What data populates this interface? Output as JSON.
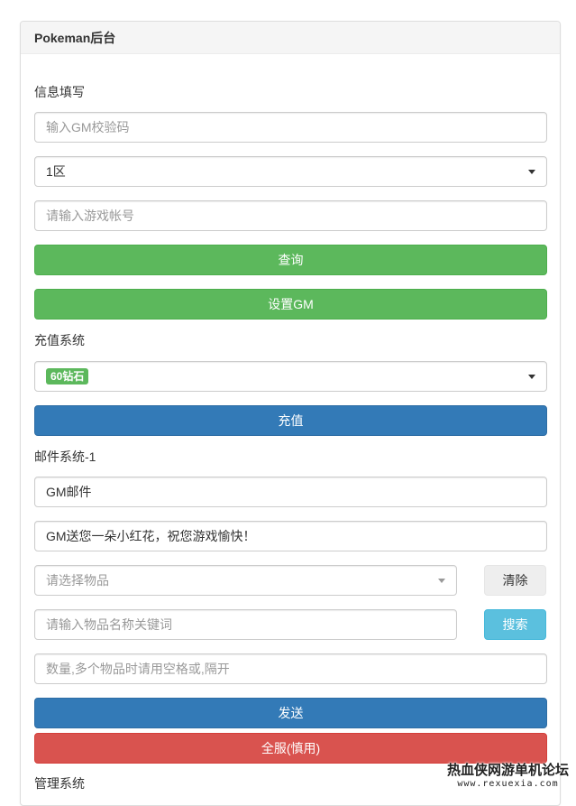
{
  "header": {
    "title": "Pokeman后台"
  },
  "info": {
    "section_label": "信息填写",
    "gm_code_placeholder": "输入GM校验码",
    "server_value": "1区",
    "account_placeholder": "请输入游戏帐号",
    "query_label": "查询",
    "set_gm_label": "设置GM"
  },
  "recharge": {
    "section_label": "充值系统",
    "selected_item": "60钻石",
    "recharge_label": "充值"
  },
  "mail": {
    "section_label": "邮件系统-1",
    "title_value": "GM邮件",
    "content_value": "GM送您一朵小红花，祝您游戏愉快！",
    "item_placeholder": "请选择物品",
    "clear_label": "清除",
    "keyword_placeholder": "请输入物品名称关键词",
    "search_label": "搜索",
    "quantity_placeholder": "数量,多个物品时请用空格或,隔开",
    "send_label": "发送",
    "all_server_label": "全服(慎用)"
  },
  "admin": {
    "section_label": "管理系统"
  },
  "watermark": {
    "line1": "热血侠网游单机论坛",
    "line2": "www.rexuexia.com"
  },
  "colors": {
    "success": "#5cb85c",
    "primary": "#337ab7",
    "danger": "#d9534f",
    "info": "#5bc0de"
  }
}
